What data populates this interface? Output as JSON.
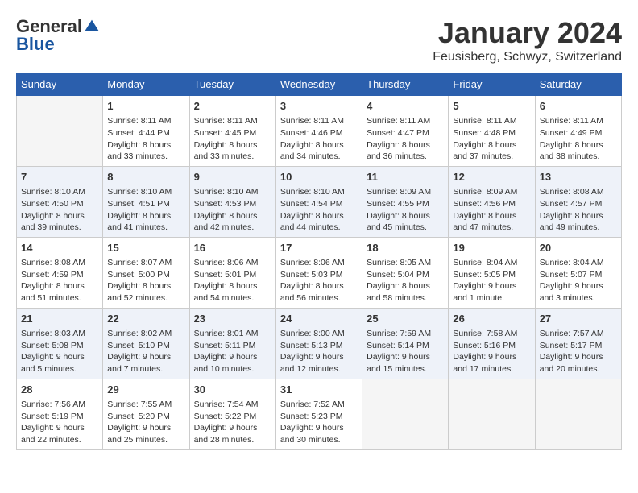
{
  "header": {
    "logo_general": "General",
    "logo_blue": "Blue",
    "month": "January 2024",
    "location": "Feusisberg, Schwyz, Switzerland"
  },
  "weekdays": [
    "Sunday",
    "Monday",
    "Tuesday",
    "Wednesday",
    "Thursday",
    "Friday",
    "Saturday"
  ],
  "weeks": [
    [
      {
        "day": "",
        "content": ""
      },
      {
        "day": "1",
        "content": "Sunrise: 8:11 AM\nSunset: 4:44 PM\nDaylight: 8 hours\nand 33 minutes."
      },
      {
        "day": "2",
        "content": "Sunrise: 8:11 AM\nSunset: 4:45 PM\nDaylight: 8 hours\nand 33 minutes."
      },
      {
        "day": "3",
        "content": "Sunrise: 8:11 AM\nSunset: 4:46 PM\nDaylight: 8 hours\nand 34 minutes."
      },
      {
        "day": "4",
        "content": "Sunrise: 8:11 AM\nSunset: 4:47 PM\nDaylight: 8 hours\nand 36 minutes."
      },
      {
        "day": "5",
        "content": "Sunrise: 8:11 AM\nSunset: 4:48 PM\nDaylight: 8 hours\nand 37 minutes."
      },
      {
        "day": "6",
        "content": "Sunrise: 8:11 AM\nSunset: 4:49 PM\nDaylight: 8 hours\nand 38 minutes."
      }
    ],
    [
      {
        "day": "7",
        "content": "Sunrise: 8:10 AM\nSunset: 4:50 PM\nDaylight: 8 hours\nand 39 minutes."
      },
      {
        "day": "8",
        "content": "Sunrise: 8:10 AM\nSunset: 4:51 PM\nDaylight: 8 hours\nand 41 minutes."
      },
      {
        "day": "9",
        "content": "Sunrise: 8:10 AM\nSunset: 4:53 PM\nDaylight: 8 hours\nand 42 minutes."
      },
      {
        "day": "10",
        "content": "Sunrise: 8:10 AM\nSunset: 4:54 PM\nDaylight: 8 hours\nand 44 minutes."
      },
      {
        "day": "11",
        "content": "Sunrise: 8:09 AM\nSunset: 4:55 PM\nDaylight: 8 hours\nand 45 minutes."
      },
      {
        "day": "12",
        "content": "Sunrise: 8:09 AM\nSunset: 4:56 PM\nDaylight: 8 hours\nand 47 minutes."
      },
      {
        "day": "13",
        "content": "Sunrise: 8:08 AM\nSunset: 4:57 PM\nDaylight: 8 hours\nand 49 minutes."
      }
    ],
    [
      {
        "day": "14",
        "content": "Sunrise: 8:08 AM\nSunset: 4:59 PM\nDaylight: 8 hours\nand 51 minutes."
      },
      {
        "day": "15",
        "content": "Sunrise: 8:07 AM\nSunset: 5:00 PM\nDaylight: 8 hours\nand 52 minutes."
      },
      {
        "day": "16",
        "content": "Sunrise: 8:06 AM\nSunset: 5:01 PM\nDaylight: 8 hours\nand 54 minutes."
      },
      {
        "day": "17",
        "content": "Sunrise: 8:06 AM\nSunset: 5:03 PM\nDaylight: 8 hours\nand 56 minutes."
      },
      {
        "day": "18",
        "content": "Sunrise: 8:05 AM\nSunset: 5:04 PM\nDaylight: 8 hours\nand 58 minutes."
      },
      {
        "day": "19",
        "content": "Sunrise: 8:04 AM\nSunset: 5:05 PM\nDaylight: 9 hours\nand 1 minute."
      },
      {
        "day": "20",
        "content": "Sunrise: 8:04 AM\nSunset: 5:07 PM\nDaylight: 9 hours\nand 3 minutes."
      }
    ],
    [
      {
        "day": "21",
        "content": "Sunrise: 8:03 AM\nSunset: 5:08 PM\nDaylight: 9 hours\nand 5 minutes."
      },
      {
        "day": "22",
        "content": "Sunrise: 8:02 AM\nSunset: 5:10 PM\nDaylight: 9 hours\nand 7 minutes."
      },
      {
        "day": "23",
        "content": "Sunrise: 8:01 AM\nSunset: 5:11 PM\nDaylight: 9 hours\nand 10 minutes."
      },
      {
        "day": "24",
        "content": "Sunrise: 8:00 AM\nSunset: 5:13 PM\nDaylight: 9 hours\nand 12 minutes."
      },
      {
        "day": "25",
        "content": "Sunrise: 7:59 AM\nSunset: 5:14 PM\nDaylight: 9 hours\nand 15 minutes."
      },
      {
        "day": "26",
        "content": "Sunrise: 7:58 AM\nSunset: 5:16 PM\nDaylight: 9 hours\nand 17 minutes."
      },
      {
        "day": "27",
        "content": "Sunrise: 7:57 AM\nSunset: 5:17 PM\nDaylight: 9 hours\nand 20 minutes."
      }
    ],
    [
      {
        "day": "28",
        "content": "Sunrise: 7:56 AM\nSunset: 5:19 PM\nDaylight: 9 hours\nand 22 minutes."
      },
      {
        "day": "29",
        "content": "Sunrise: 7:55 AM\nSunset: 5:20 PM\nDaylight: 9 hours\nand 25 minutes."
      },
      {
        "day": "30",
        "content": "Sunrise: 7:54 AM\nSunset: 5:22 PM\nDaylight: 9 hours\nand 28 minutes."
      },
      {
        "day": "31",
        "content": "Sunrise: 7:52 AM\nSunset: 5:23 PM\nDaylight: 9 hours\nand 30 minutes."
      },
      {
        "day": "",
        "content": ""
      },
      {
        "day": "",
        "content": ""
      },
      {
        "day": "",
        "content": ""
      }
    ]
  ]
}
